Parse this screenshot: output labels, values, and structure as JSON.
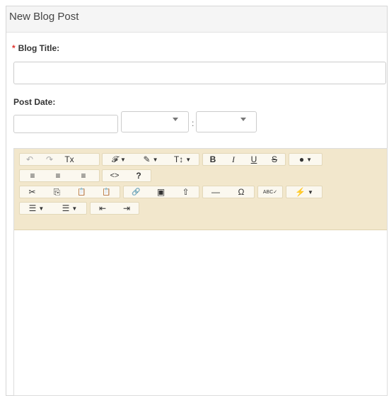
{
  "panel": {
    "title": "New Blog Post"
  },
  "form": {
    "blog_title_required": "*",
    "blog_title_label": "Blog Title:",
    "blog_title_value": "",
    "post_date_label": "Post Date:",
    "post_date_value": "",
    "hour_value": "",
    "minute_value": "",
    "time_separator": ":"
  },
  "toolbar": {
    "undo": "↶",
    "redo": "↷",
    "clear_format": "Tx",
    "font_family": "𝓕",
    "font_color": "✎",
    "font_size": "T↕",
    "bold": "B",
    "italic": "I",
    "underline": "U",
    "strike": "S",
    "fill_color": "●",
    "align_left": "≡",
    "align_center": "≡",
    "align_right": "≡",
    "code_view": "<>",
    "help": "?",
    "cut": "✂",
    "copy": "⎘",
    "paste": "📋",
    "paste_plain": "📋",
    "link": "🔗",
    "image": "▣",
    "upload": "⇧",
    "hr": "—",
    "special_char": "Ω",
    "spellcheck": "ABC✓",
    "quick_insert": "⚡",
    "ul": "☰",
    "ol": "☰",
    "outdent": "⇤",
    "indent": "⇥",
    "dropdown": "▼"
  },
  "editor": {
    "content": ""
  }
}
